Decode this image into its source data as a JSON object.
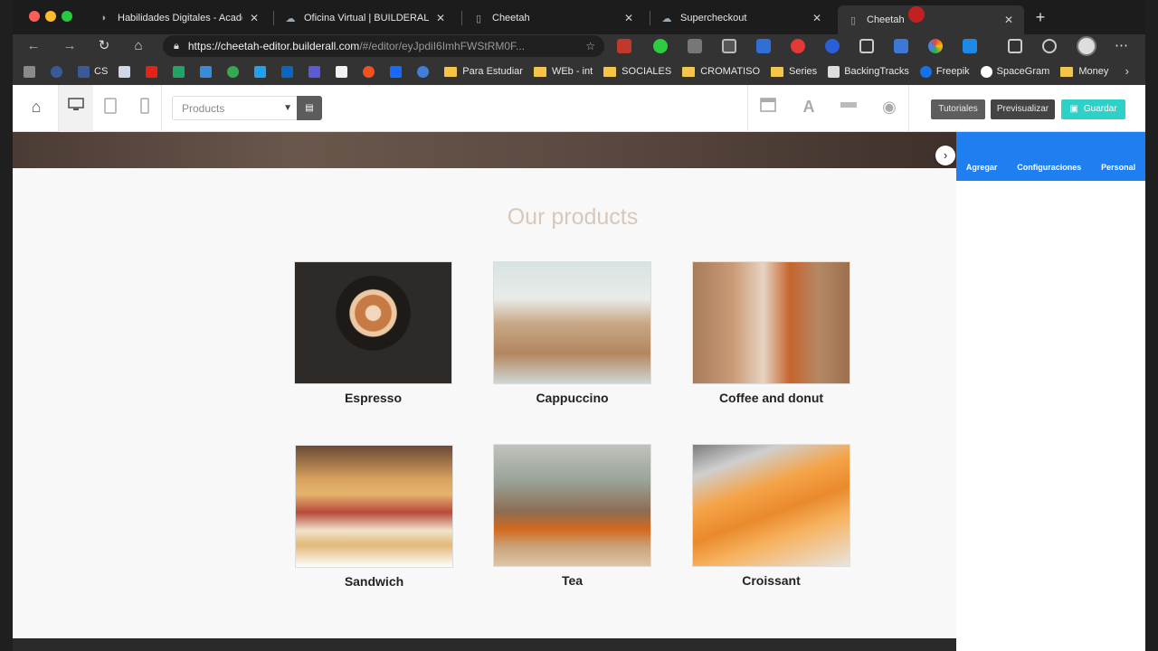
{
  "browser": {
    "tabs": [
      {
        "title": "Habilidades Digitales - Academ",
        "icon": "academy-icon"
      },
      {
        "title": "Oficina Virtual | BUILDERALL",
        "icon": "builderall-icon"
      },
      {
        "title": "Cheetah",
        "icon": "page-icon"
      },
      {
        "title": "Supercheckout",
        "icon": "builderall-icon"
      },
      {
        "title": "Cheetah",
        "icon": "page-icon",
        "active": true
      }
    ],
    "url_host": "https://cheetah-editor.builderall.com",
    "url_rest": "/#/editor/eyJpdiI6ImhFWStRM0F...",
    "bookmarks": [
      {
        "label": "",
        "color": "#8a8a8a"
      },
      {
        "label": "",
        "color": "#3b5998"
      },
      {
        "label": "CS",
        "color": "#3b5998"
      },
      {
        "label": "",
        "color": "#cfd8e8"
      },
      {
        "label": "",
        "color": "#e62117"
      },
      {
        "label": "",
        "color": "#1fa463"
      },
      {
        "label": "",
        "color": "#3c8bd9"
      },
      {
        "label": "",
        "color": "#34a853"
      },
      {
        "label": "",
        "color": "#1da1f2"
      },
      {
        "label": "",
        "color": "#0a66c2"
      },
      {
        "label": "",
        "color": "#5b5bd6"
      },
      {
        "label": "",
        "color": "#f2f2f2"
      },
      {
        "label": "",
        "color": "#f25022"
      },
      {
        "label": "",
        "color": "#1769ff"
      },
      {
        "label": "",
        "color": "#3f7fd9"
      },
      {
        "label": "Para Estudiar",
        "folder": true
      },
      {
        "label": "WEb - int",
        "folder": true
      },
      {
        "label": "SOCIALES",
        "folder": true
      },
      {
        "label": "CROMATISO",
        "folder": true
      },
      {
        "label": "Series",
        "folder": true
      },
      {
        "label": "BackingTracks",
        "color": "#dddddd"
      },
      {
        "label": "Freepik",
        "color": "#1273eb"
      },
      {
        "label": "SpaceGram",
        "color": "#ffffff"
      },
      {
        "label": "Money",
        "folder": true
      }
    ]
  },
  "editor": {
    "page_select": "Products",
    "btn_tutorials": "Tutoriales",
    "btn_preview": "Previsualizar",
    "btn_save": "Guardar",
    "colors": {
      "accent": "#1f7ff0",
      "save": "#2ed1c8",
      "dark_btn": "#4a4a4a"
    }
  },
  "page": {
    "section_title": "Our products",
    "products": [
      {
        "name": "Espresso"
      },
      {
        "name": "Cappuccino"
      },
      {
        "name": "Coffee and donut"
      },
      {
        "name": "Sandwich"
      },
      {
        "name": "Tea"
      },
      {
        "name": "Croissant"
      }
    ]
  },
  "panel": {
    "tabs": [
      "Agregar",
      "Configuraciones",
      "Personal"
    ]
  }
}
